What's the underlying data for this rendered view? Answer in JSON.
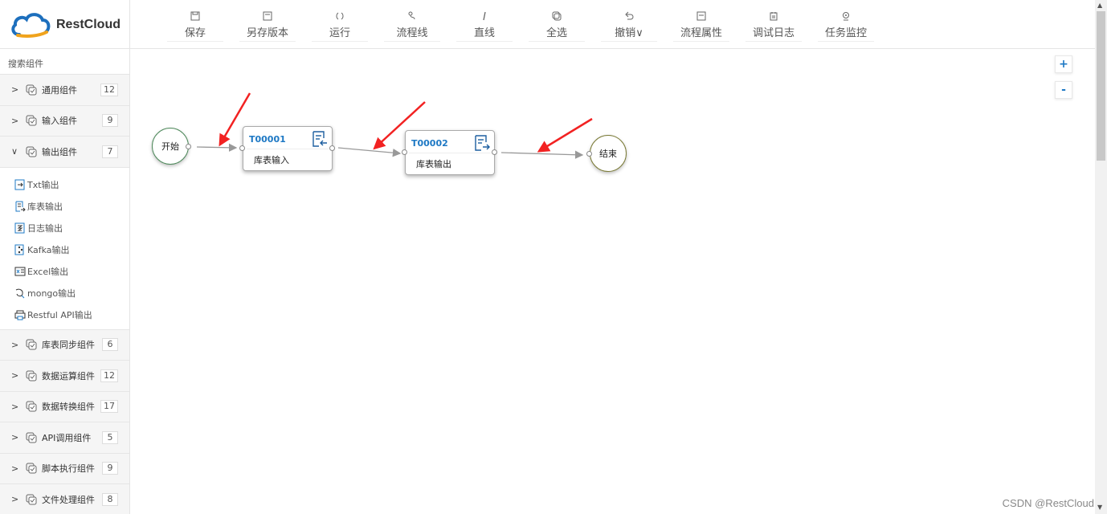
{
  "app": {
    "name": "RestCloud"
  },
  "toolbar": [
    {
      "label": "保存",
      "icon": "save-icon"
    },
    {
      "label": "另存版本",
      "icon": "save-as-icon"
    },
    {
      "label": "运行",
      "icon": "run-icon"
    },
    {
      "label": "流程线",
      "icon": "flow-line-icon"
    },
    {
      "label": "直线",
      "icon": "straight-line-icon"
    },
    {
      "label": "全选",
      "icon": "select-all-icon"
    },
    {
      "label": "撤销∨",
      "icon": "undo-icon"
    },
    {
      "label": "流程属性",
      "icon": "process-properties-icon"
    },
    {
      "label": "调试日志",
      "icon": "debug-log-icon"
    },
    {
      "label": "任务监控",
      "icon": "task-monitor-icon"
    }
  ],
  "sidebar": {
    "search_placeholder": "搜索组件",
    "groups_top": [
      {
        "label": "通用组件",
        "count": "12"
      },
      {
        "label": "输入组件",
        "count": "9"
      }
    ],
    "open_group": {
      "label": "输出组件",
      "count": "7"
    },
    "output_items": [
      {
        "label": "Txt输出",
        "icon": "txt-output-icon"
      },
      {
        "label": "库表输出",
        "icon": "table-output-icon"
      },
      {
        "label": "日志输出",
        "icon": "log-output-icon"
      },
      {
        "label": "Kafka输出",
        "icon": "kafka-output-icon"
      },
      {
        "label": "Excel输出",
        "icon": "excel-output-icon"
      },
      {
        "label": "mongo输出",
        "icon": "mongo-output-icon"
      },
      {
        "label": "Restful API输出",
        "icon": "restful-api-output-icon"
      }
    ],
    "groups_bottom": [
      {
        "label": "库表同步组件",
        "count": "6"
      },
      {
        "label": "数据运算组件",
        "count": "12"
      },
      {
        "label": "数据转换组件",
        "count": "17"
      },
      {
        "label": "API调用组件",
        "count": "5"
      },
      {
        "label": "脚本执行组件",
        "count": "9"
      },
      {
        "label": "文件处理组件",
        "count": "8"
      }
    ]
  },
  "canvas": {
    "zoom_in": "+",
    "zoom_out": "-",
    "start_label": "开始",
    "end_label": "结束",
    "task1": {
      "id": "T00001",
      "name": "库表输入"
    },
    "task2": {
      "id": "T00002",
      "name": "库表输出"
    }
  },
  "watermark": "CSDN @RestCloud",
  "colors": {
    "accent": "#1d78c4",
    "annotation_arrow": "#f22222"
  }
}
